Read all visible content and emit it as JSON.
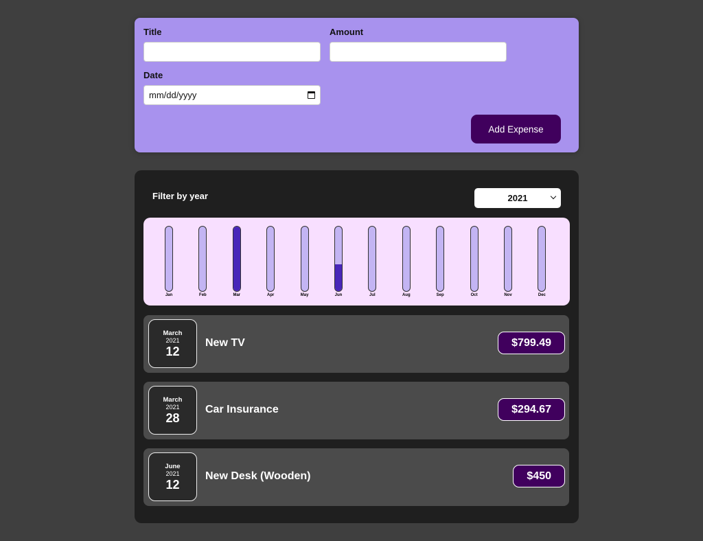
{
  "form": {
    "title_label": "Title",
    "title_value": "",
    "amount_label": "Amount",
    "amount_value": "",
    "date_label": "Date",
    "date_placeholder": "mm/dd/yyyy",
    "submit_label": "Add Expense"
  },
  "filter": {
    "label": "Filter by year",
    "selected_year": "2021"
  },
  "chart_data": {
    "type": "bar",
    "categories": [
      "Jan",
      "Feb",
      "Mar",
      "Apr",
      "May",
      "Jun",
      "Jul",
      "Aug",
      "Sep",
      "Oct",
      "Nov",
      "Dec"
    ],
    "values": [
      0,
      0,
      1094.16,
      0,
      0,
      450,
      0,
      0,
      0,
      0,
      0,
      0
    ],
    "ylim": [
      0,
      1094.16
    ]
  },
  "expenses": [
    {
      "month": "March",
      "year": "2021",
      "day": "12",
      "title": "New TV",
      "amount": "$799.49"
    },
    {
      "month": "March",
      "year": "2021",
      "day": "28",
      "title": "Car Insurance",
      "amount": "$294.67"
    },
    {
      "month": "June",
      "year": "2021",
      "day": "12",
      "title": "New Desk (Wooden)",
      "amount": "$450"
    }
  ],
  "colors": {
    "form_bg": "#a892ee",
    "accent": "#40005d",
    "bar_fill": "#4826b9",
    "bar_empty": "#c3b4f3",
    "chart_bg": "#f8dfff"
  }
}
